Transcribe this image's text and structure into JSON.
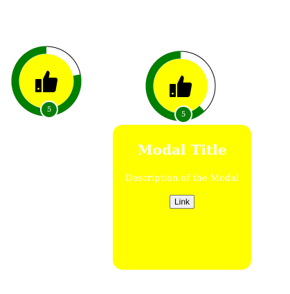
{
  "widgets": [
    {
      "icon": "thumbs-up-icon",
      "badge": "5",
      "progress": 0.78,
      "ring_color": "#008000",
      "fill_color": "#ffff00"
    },
    {
      "icon": "thumbs-up-icon",
      "badge": "5",
      "progress": 0.62,
      "ring_color": "#008000",
      "fill_color": "#ffff00"
    }
  ],
  "modal": {
    "title": "Modal Title",
    "description": "Description of the Modal",
    "link_label": "Link",
    "background": "#ffff00"
  }
}
